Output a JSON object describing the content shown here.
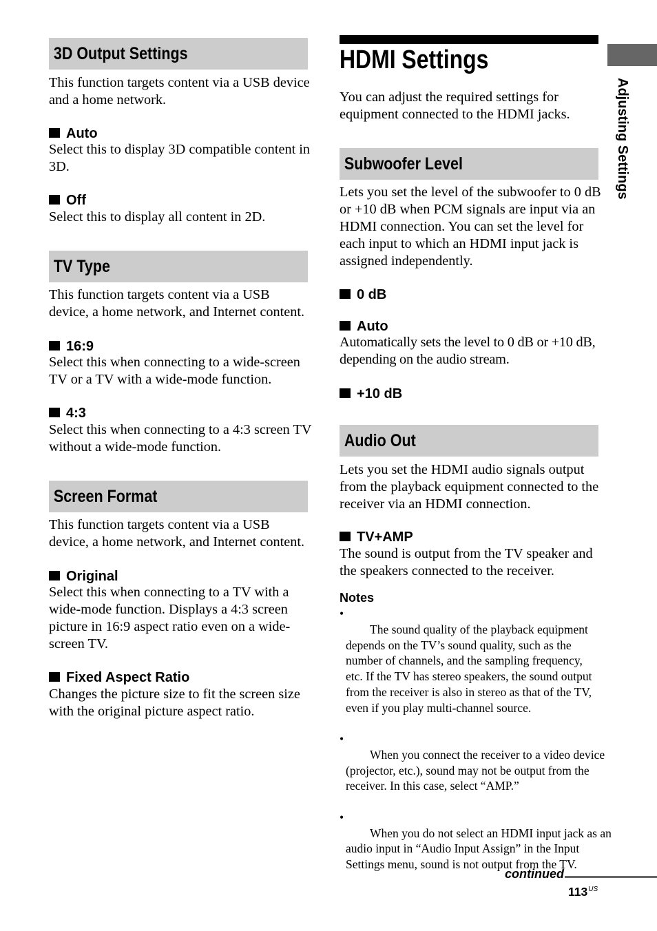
{
  "colors": {
    "section_header_bg": "#cccccc",
    "side_tab_bg": "#666666",
    "title_rule": "#000000",
    "footer_rule": "#666666"
  },
  "side_tab": {
    "label": "Adjusting Settings"
  },
  "left_column": {
    "sections": [
      {
        "title": "3D Output Settings",
        "description": "This function targets content via a USB device\nand a home network.",
        "options": [
          {
            "label": "Auto",
            "description": "Select this to display 3D compatible content in\n3D."
          },
          {
            "label": "Off",
            "description": "Select this to display all content in 2D."
          }
        ]
      },
      {
        "title": "TV Type",
        "description": "This function targets content via a USB\ndevice, a home network, and Internet content.",
        "options": [
          {
            "label": "16:9",
            "description": "Select this when connecting to a wide-screen\nTV or a TV with a wide-mode function."
          },
          {
            "label": "4:3",
            "description": "Select this when connecting to a 4:3 screen TV\nwithout a wide-mode function."
          }
        ]
      },
      {
        "title": "Screen Format",
        "description": "This function targets content via a USB\ndevice, a home network, and Internet content.",
        "options": [
          {
            "label": "Original",
            "description": "Select this when connecting to a TV with a\nwide-mode function. Displays a 4:3 screen\npicture in 16:9 aspect ratio even on a wide-\nscreen TV."
          },
          {
            "label": "Fixed Aspect Ratio",
            "description": "Changes the picture size to fit the screen size\nwith the original picture aspect ratio."
          }
        ]
      }
    ]
  },
  "right_column": {
    "chapter_title": "HDMI Settings",
    "intro": "You can adjust the required settings for\nequipment connected to the HDMI jacks.",
    "sections": [
      {
        "title": "Subwoofer Level",
        "description": "Lets you set the level of the subwoofer to 0 dB\nor +10 dB when PCM signals are input via an\nHDMI connection. You can set the level for\neach input to which an HDMI input jack is\nassigned independently.",
        "options": [
          {
            "label": "0 dB"
          },
          {
            "label": "Auto",
            "description": "Automatically sets the level to 0 dB or +10 dB,\ndepending on the audio stream."
          },
          {
            "label": "+10 dB"
          }
        ]
      },
      {
        "title": "Audio Out",
        "description": "Lets you set the HDMI audio signals output\nfrom the playback equipment connected to the\nreceiver via an HDMI connection.",
        "options": [
          {
            "label": "TV+AMP",
            "description": "The sound is output from the TV speaker and\nthe speakers connected to the receiver."
          }
        ]
      }
    ],
    "notes": {
      "heading": "Notes",
      "bullet": "•",
      "items": [
        "The sound quality of the playback equipment\ndepends on the TV’s sound quality, such as the\nnumber of channels, and the sampling frequency,\netc. If the TV has stereo speakers, the sound output\nfrom the receiver is also in stereo as that of the TV,\neven if you play multi-channel source.",
        "When you connect the receiver to a video device\n(projector, etc.), sound may not be output from the\nreceiver. In this case, select “AMP.”",
        "When you do not select an HDMI input jack as an\naudio input in “Audio Input Assign” in the Input\nSettings menu, sound is not output from the TV."
      ]
    }
  },
  "footer": {
    "continued": "continued",
    "page_number": "113",
    "page_suffix": "US"
  }
}
